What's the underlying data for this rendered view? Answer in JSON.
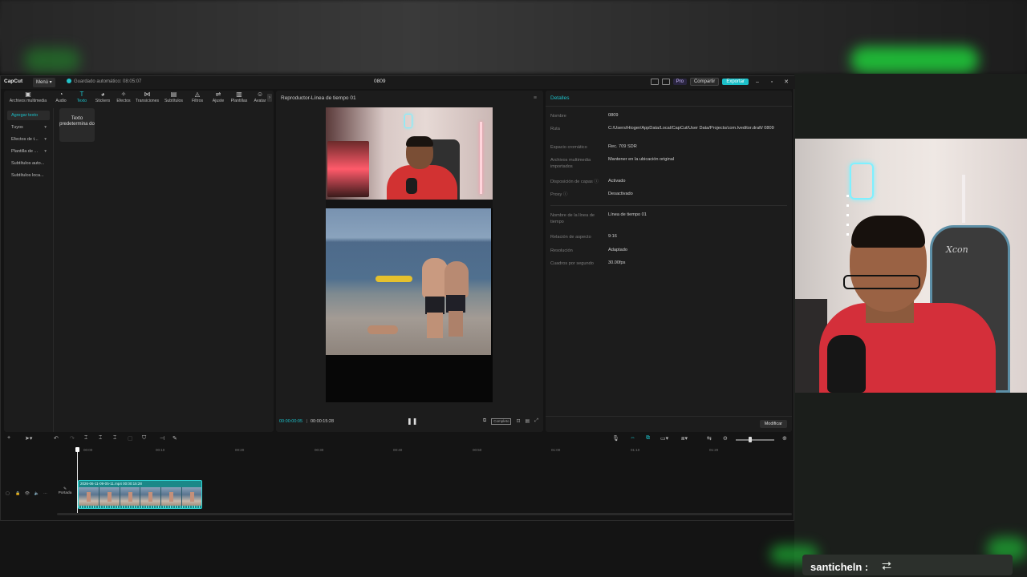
{
  "titlebar": {
    "logo": "CapCut",
    "menu": "Menú ▾",
    "autosave": "Guardado automático: 08:05:07",
    "project_title": "0809",
    "pro": "Pro",
    "share": "Compartir",
    "export": "Exportar",
    "win_min": "–",
    "win_max": "▫",
    "win_close": "✕"
  },
  "toolbar": {
    "items": [
      {
        "label": "Archivos multimedia",
        "icon": "media-icon"
      },
      {
        "label": "Audio",
        "icon": "audio-icon"
      },
      {
        "label": "Texto",
        "icon": "text-icon"
      },
      {
        "label": "Stickers",
        "icon": "sticker-icon"
      },
      {
        "label": "Efectos",
        "icon": "effects-icon"
      },
      {
        "label": "Transiciones",
        "icon": "transitions-icon"
      },
      {
        "label": "Subtítulos",
        "icon": "subtitles-icon"
      },
      {
        "label": "Filtros",
        "icon": "filters-icon"
      },
      {
        "label": "Ajuste",
        "icon": "adjust-icon"
      },
      {
        "label": "Plantillas",
        "icon": "templates-icon"
      },
      {
        "label": "Avatar",
        "icon": "avatar-icon"
      }
    ],
    "active": "Texto"
  },
  "text_panel": {
    "side_items": [
      "Agregar texto",
      "Tuyos",
      "Efectos de t...",
      "Plantilla de ...",
      "Subtítulos auto...",
      "Subtítulos loca..."
    ],
    "card": "Texto predetermina do"
  },
  "player": {
    "title": "Reproductor-Línea de tiempo 01",
    "current_time": "00:00:00:05",
    "total_time": "00:00:15:28",
    "ratio_button": "Completo"
  },
  "details": {
    "title": "Detalles",
    "rows": [
      {
        "k": "Nombre",
        "v": "0809"
      },
      {
        "k": "Ruta",
        "v": "C:/Users/Hioger/AppData/Local/CapCut/User Data/Projects/com.lveditor.draft/ 0809"
      },
      {
        "k": "Espacio cromático",
        "v": "Rec. 709 SDR"
      },
      {
        "k": "Archivos multimedia importados",
        "v": "Mantener en la ubicación original"
      },
      {
        "k": "Disposición de capas ⓘ",
        "v": "Activado"
      },
      {
        "k": "Proxy ⓘ",
        "v": "Desactivado"
      },
      {
        "k": "Nombre de la línea de tiempo",
        "v": "Línea de tiempo 01"
      },
      {
        "k": "Relación de aspecto",
        "v": "9:16"
      },
      {
        "k": "Resolución",
        "v": "Adaptado"
      },
      {
        "k": "Cuadros por segundo",
        "v": "30.00fps"
      }
    ],
    "modify_button": "Modificar"
  },
  "timeline": {
    "ruler": [
      "00:00",
      "00:10",
      "00:20",
      "00:30",
      "00:40",
      "00:50",
      "01:00",
      "01:10",
      "01:20"
    ],
    "cover_label": "Portada",
    "clip_label": "2026-06-11-09-05-11.mp4   00:00:15:28"
  },
  "overlay": {
    "chair_text": "Xcon",
    "chat_user": "santicheln :",
    "chat_icon": "⮂"
  }
}
